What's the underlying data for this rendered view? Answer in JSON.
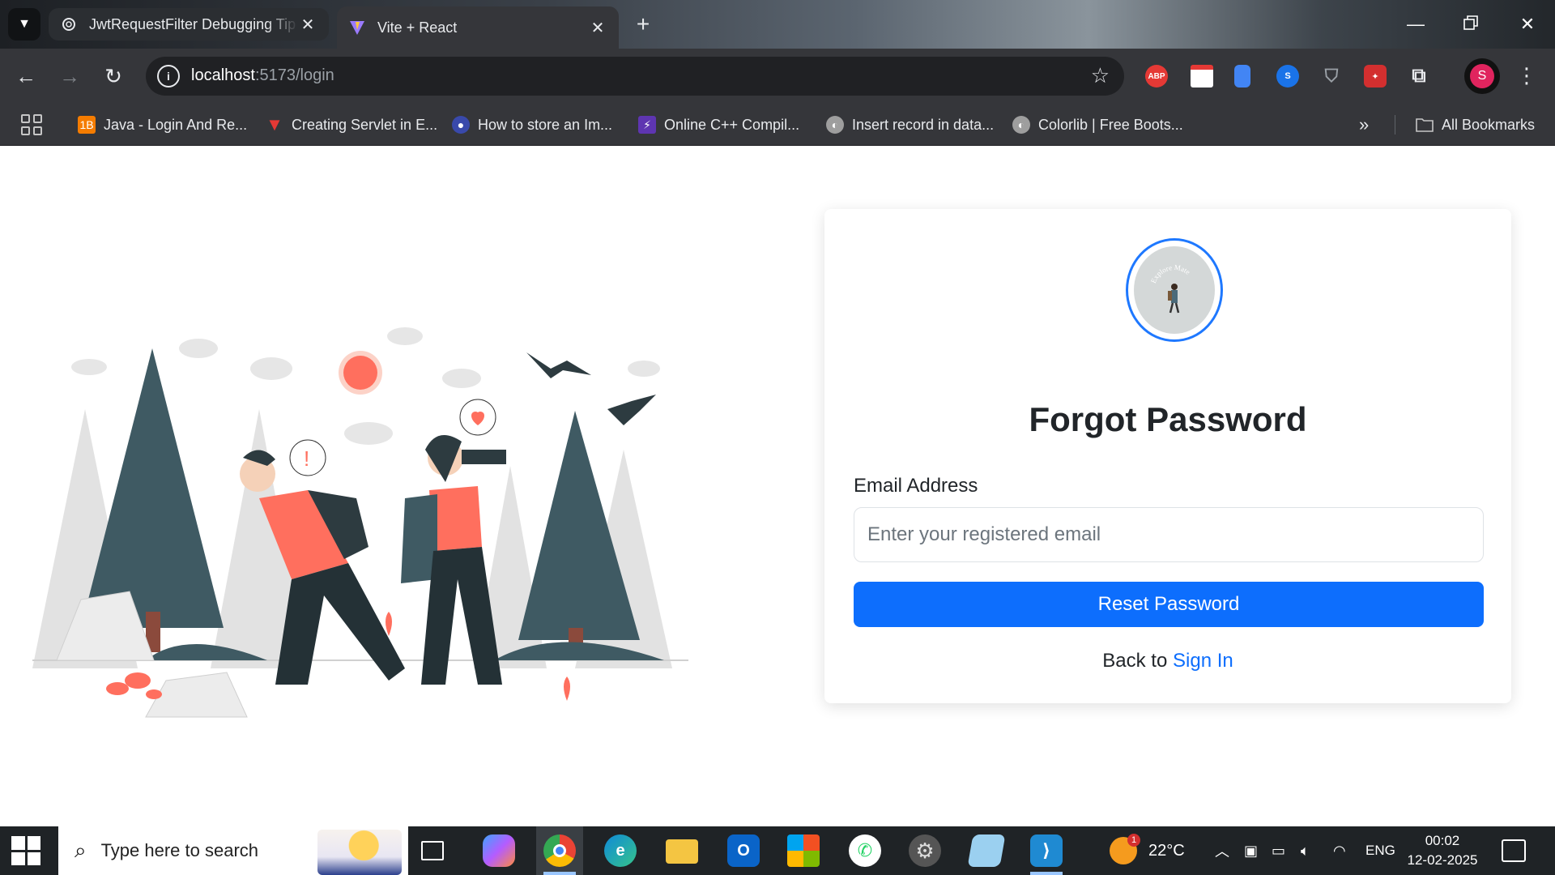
{
  "browser": {
    "tabs": [
      {
        "title": "JwtRequestFilter Debugging Tip",
        "favicon": "chatgpt-icon",
        "active": false
      },
      {
        "title": "Vite + React",
        "favicon": "vite-icon",
        "active": true
      }
    ],
    "url_host": "localhost",
    "url_path": ":5173/login",
    "profile_initial": "S",
    "extensions": [
      "adblock-plus-icon",
      "calendar-icon",
      "docs-icon",
      "shazam-icon",
      "shield-icon",
      "puzzle-red-icon",
      "puzzle-icon"
    ],
    "bookmarks": [
      {
        "label": "Java - Login And Re...",
        "icon": "1b-icon",
        "color": "#f57c00"
      },
      {
        "label": "Creating Servlet in E...",
        "icon": "v-icon",
        "color": "#e53935"
      },
      {
        "label": "How to store an Im...",
        "icon": "user-icon",
        "color": "#3949ab"
      },
      {
        "label": "Online C++ Compil...",
        "icon": "bolt-icon",
        "color": "#5e35b1"
      },
      {
        "label": "Insert record in data...",
        "icon": "globe-icon",
        "color": "#9e9e9e"
      },
      {
        "label": "Colorlib | Free Boots...",
        "icon": "globe-icon",
        "color": "#9e9e9e"
      }
    ],
    "all_bookmarks": "All Bookmarks",
    "more_bookmarks": "»"
  },
  "page": {
    "title": "Forgot Password",
    "email_label": "Email Address",
    "email_placeholder": "Enter your registered email",
    "email_value": "",
    "reset_button": "Reset Password",
    "back_text": "Back to",
    "sign_in_link": "Sign In",
    "logo_text": "Explore Mate",
    "accent_color": "#0d6efd"
  },
  "taskbar": {
    "search_placeholder": "Type here to search",
    "weather_temp": "22°C",
    "weather_badge": "1",
    "language": "ENG",
    "time": "00:02",
    "date": "12-02-2025",
    "apps": [
      "task-view-icon",
      "copilot-icon",
      "chrome-icon",
      "edge-icon",
      "file-explorer-icon",
      "outlook-icon",
      "store-icon",
      "whatsapp-icon",
      "settings-app-icon",
      "notepad-icon",
      "vscode-icon"
    ]
  }
}
